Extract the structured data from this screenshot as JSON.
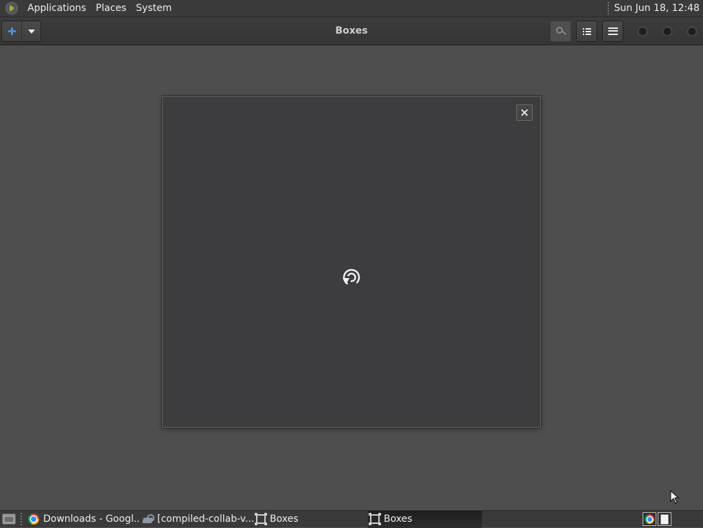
{
  "top_panel": {
    "menus": [
      "Applications",
      "Places",
      "System"
    ],
    "clock": "Sun Jun 18, 12:48"
  },
  "headerbar": {
    "title": "Boxes",
    "new_button_icon": "plus-icon",
    "new_menu_icon": "chevron-down-icon",
    "search_icon": "search-icon",
    "selection_icon": "list-icon",
    "menu_icon": "hamburger-menu-icon",
    "window_controls": [
      "minimize",
      "maximize",
      "close"
    ]
  },
  "dialog": {
    "close_icon": "close-icon",
    "content_icon": "loading-spinner-icon"
  },
  "taskbar": {
    "tasks": [
      {
        "label": "Downloads - Googl...",
        "icon": "chrome-icon",
        "active": false
      },
      {
        "label": "[compiled-collab-v...",
        "icon": "tool-icon",
        "active": false
      },
      {
        "label": "Boxes",
        "icon": "boxes-icon",
        "active": false
      },
      {
        "label": "Boxes",
        "icon": "boxes-icon",
        "active": true
      }
    ],
    "tray": [
      "chrome-icon",
      "page-icon"
    ]
  },
  "colors": {
    "desktop_bg": "#4e4e4e",
    "panel_bg": "#3a3a3a",
    "dialog_bg": "#3d3d3f",
    "accent": "#4a90d9"
  }
}
